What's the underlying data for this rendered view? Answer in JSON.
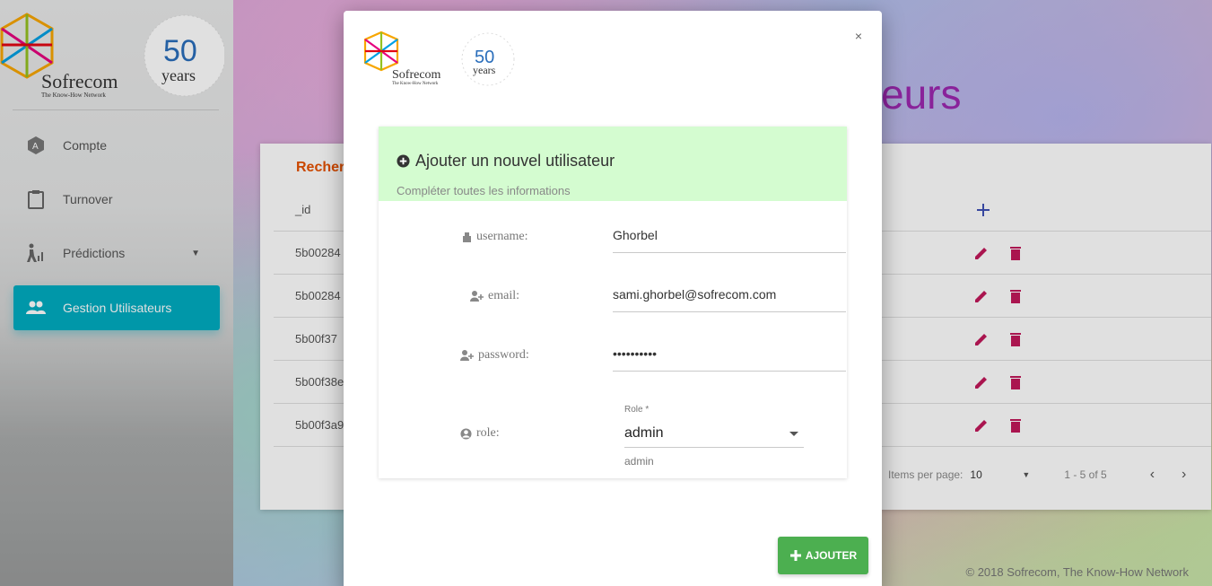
{
  "sidebar": {
    "brand": "Sofrecom",
    "tagline": "The Know-How Network",
    "anniversary": "50 years",
    "items": [
      {
        "label": "Compte",
        "icon": "account-badge-icon"
      },
      {
        "label": "Turnover",
        "icon": "clipboard-icon"
      },
      {
        "label": "Prédictions",
        "icon": "person-chart-icon"
      },
      {
        "label": "Gestion Utilisateurs",
        "icon": "people-icon"
      }
    ]
  },
  "main": {
    "title_partial": "eurs",
    "search_label_partial": "Recher",
    "table": {
      "header_id": "_id",
      "rows": [
        "5b00284",
        "5b00284",
        "5b00f37",
        "5b00f38e",
        "5b00f3a9"
      ]
    },
    "pager": {
      "items_per_page_label": "Items per page:",
      "items_per_page": "10",
      "range": "1 - 5 of 5"
    },
    "footer": "© 2018 Sofrecom, The Know-How Network"
  },
  "modal": {
    "close_label": "×",
    "brand": "Sofrecom",
    "tagline": "The Know-How Network",
    "anniversary": "50 years",
    "form_title": "Ajouter un nouvel utilisateur",
    "form_subtitle": "Compléter toutes les informations",
    "fields": {
      "username_label": "username:",
      "username_value": "Ghorbel",
      "email_label": "email:",
      "email_value": "sami.ghorbel@sofrecom.com",
      "password_label": "password:",
      "password_value": "••••••••••",
      "role_label": "role:",
      "role_caption": "Role *",
      "role_value": "admin",
      "role_hint": "admin"
    },
    "submit_label": "AJOUTER"
  },
  "colors": {
    "active_nav": "#00acc1",
    "form_header": "#d4fcd0",
    "submit": "#4caf50",
    "action_icons": "#c2185b"
  }
}
